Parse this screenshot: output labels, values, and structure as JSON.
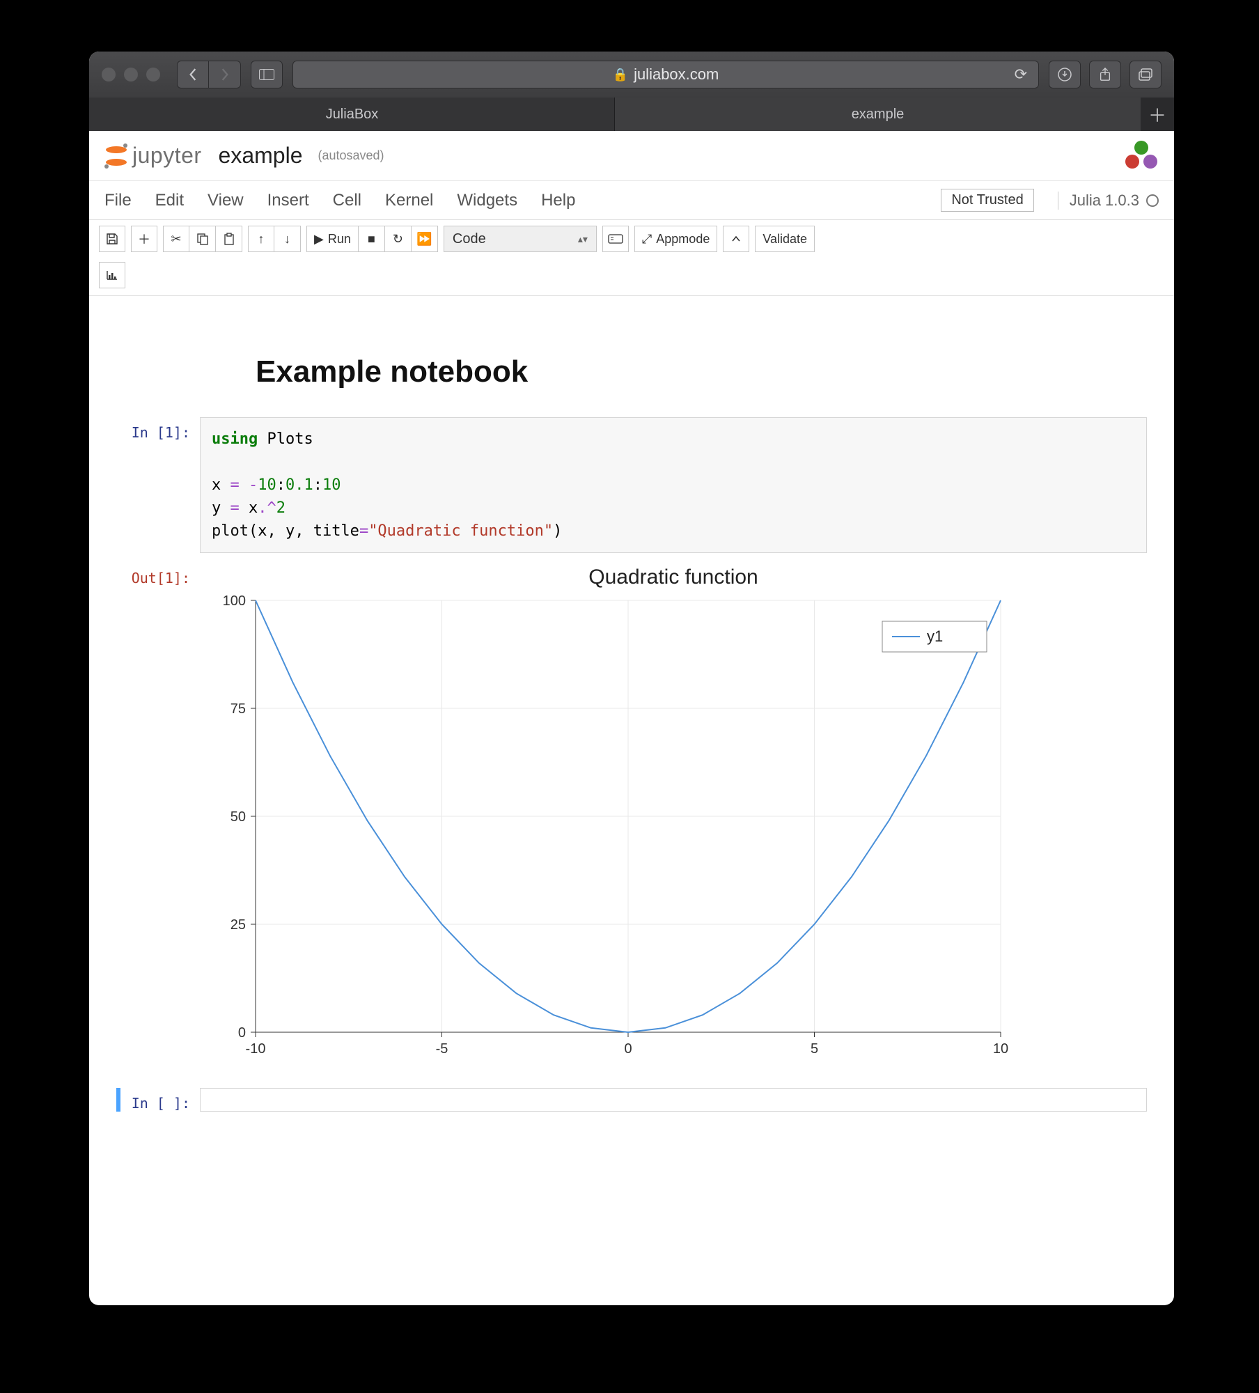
{
  "browser": {
    "url_host": "juliabox.com",
    "tabs": [
      "JuliaBox",
      "example"
    ],
    "active_tab_index": 1
  },
  "jupyter": {
    "logo_text": "jupyter",
    "notebook_title": "example",
    "save_status": "(autosaved)",
    "menus": [
      "File",
      "Edit",
      "View",
      "Insert",
      "Cell",
      "Kernel",
      "Widgets",
      "Help"
    ],
    "trust": "Not Trusted",
    "kernel": "Julia 1.0.3"
  },
  "toolbar": {
    "run_label": "Run",
    "appmode_label": "Appmode",
    "validate_label": "Validate",
    "celltype_value": "Code"
  },
  "notebook": {
    "heading": "Example notebook",
    "cell1": {
      "in_prompt": "In [1]:",
      "out_prompt": "Out[1]:",
      "code": {
        "l1_kw": "using",
        "l1_mod": "Plots",
        "l2_pre": "x ",
        "l2_op": "= -",
        "l2_a": "10",
        "l2_colon1": ":",
        "l2_b": "0.1",
        "l2_colon2": ":",
        "l2_c": "10",
        "l3_pre": "y ",
        "l3_op": "=",
        "l3_rest": " x",
        "l3_dot": ".^",
        "l3_pow": "2",
        "l4_fn": "plot",
        "l4_open": "(x, y, title",
        "l4_eq": "=",
        "l4_str": "\"Quadratic function\"",
        "l4_close": ")"
      }
    },
    "cell2": {
      "in_prompt": "In [ ]:"
    }
  },
  "chart_data": {
    "type": "line",
    "title": "Quadratic function",
    "xlabel": "",
    "ylabel": "",
    "xlim": [
      -10,
      10
    ],
    "ylim": [
      0,
      100
    ],
    "x_ticks": [
      -10,
      -5,
      0,
      5,
      10
    ],
    "y_ticks": [
      0,
      25,
      50,
      75,
      100
    ],
    "legend": {
      "entries": [
        "y1"
      ],
      "position": "top-right"
    },
    "series": [
      {
        "name": "y1",
        "x": [
          -10,
          -9,
          -8,
          -7,
          -6,
          -5,
          -4,
          -3,
          -2,
          -1,
          0,
          1,
          2,
          3,
          4,
          5,
          6,
          7,
          8,
          9,
          10
        ],
        "y": [
          100,
          81,
          64,
          49,
          36,
          25,
          16,
          9,
          4,
          1,
          0,
          1,
          4,
          9,
          16,
          25,
          36,
          49,
          64,
          81,
          100
        ],
        "color": "#4a90d9"
      }
    ]
  }
}
